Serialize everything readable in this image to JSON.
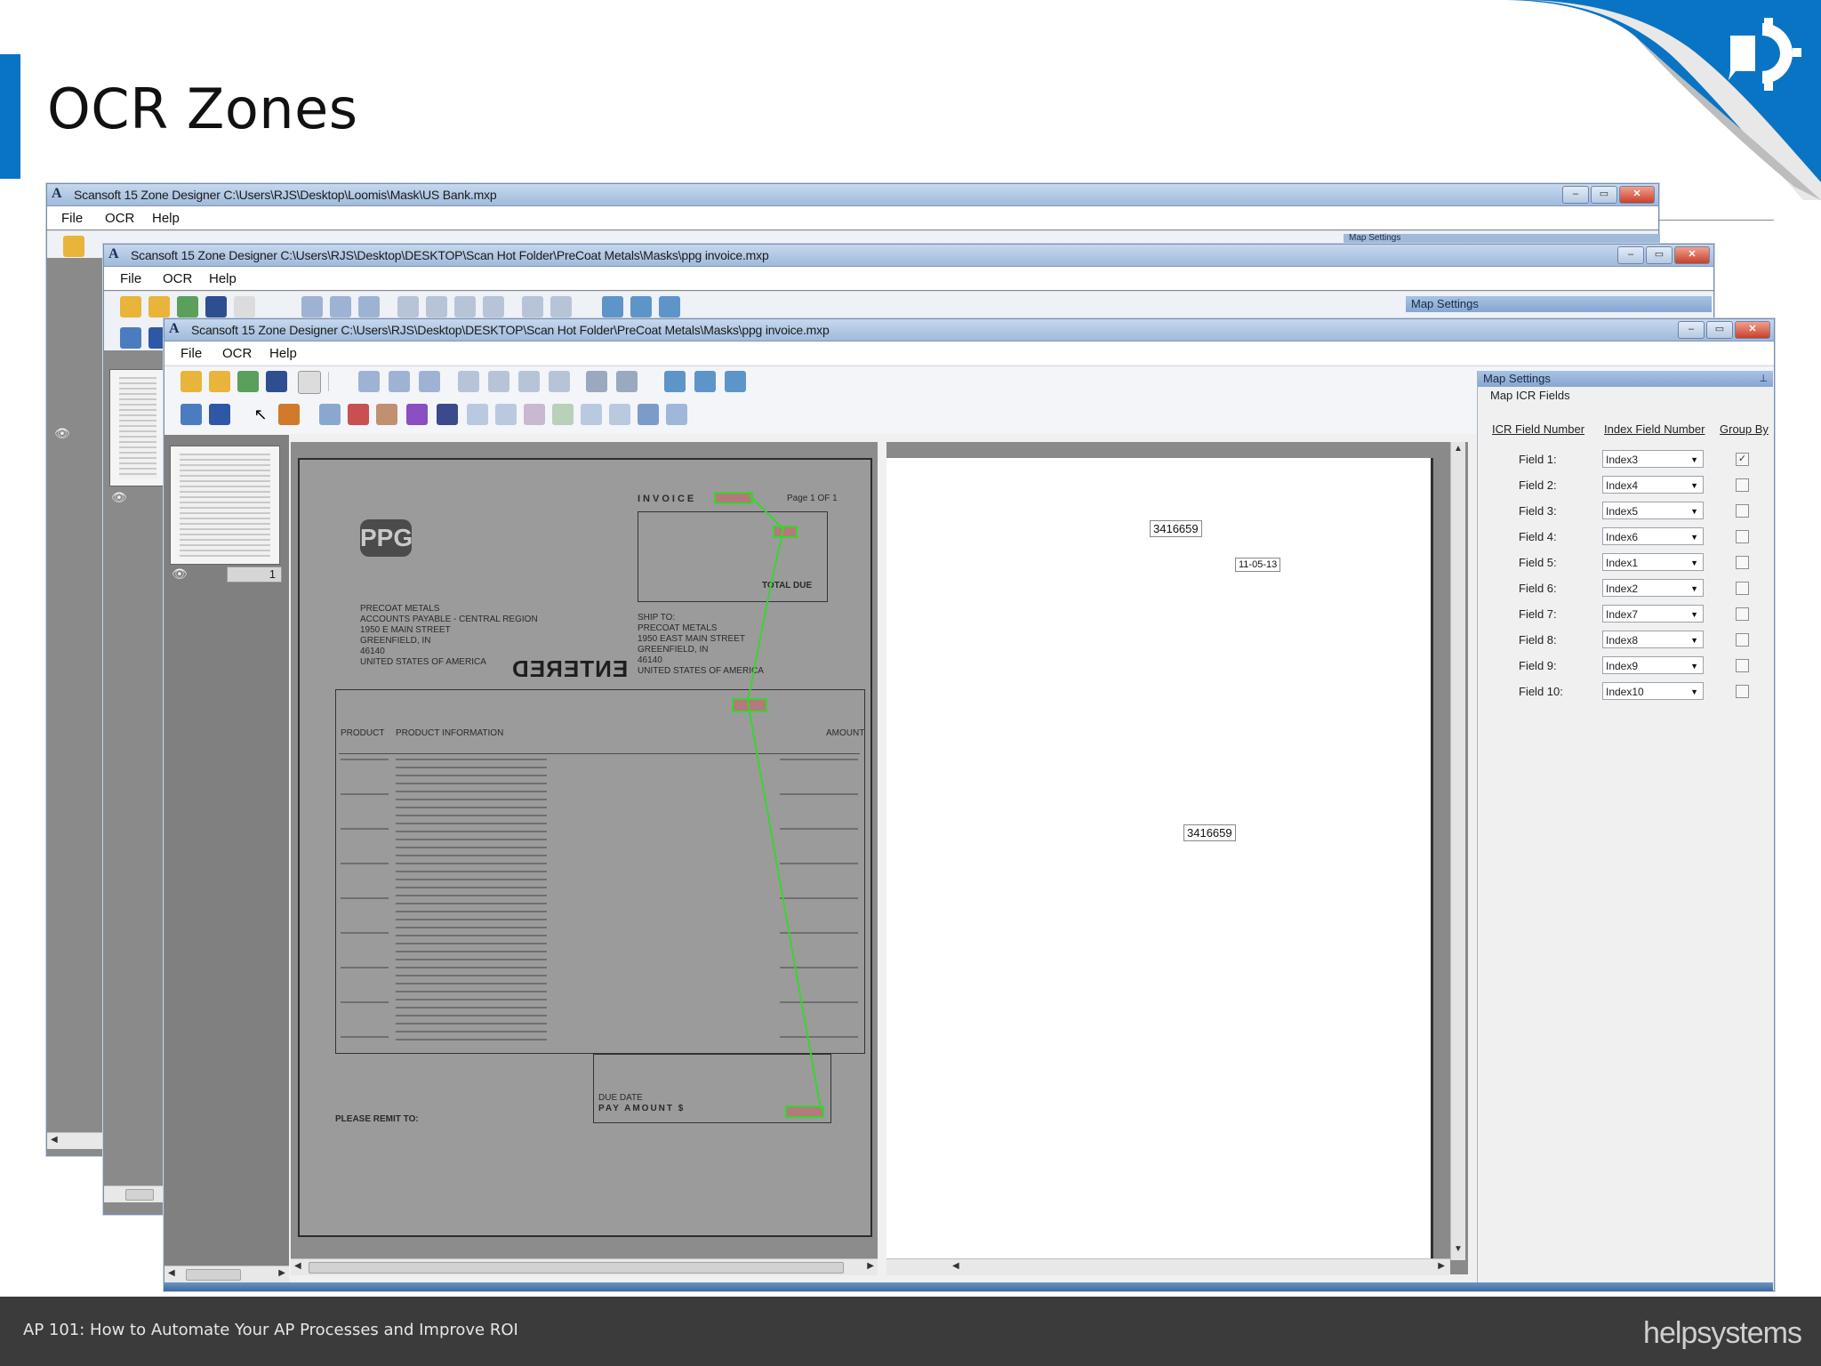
{
  "slide": {
    "title": "OCR Zones",
    "footer_text": "AP 101: How to Automate Your AP Processes and Improve ROI",
    "footer_logo": "helpsystems"
  },
  "colors": {
    "accent": "#0a74c4",
    "footer_bg": "#3b3b3b",
    "zone_green": "#3ad431"
  },
  "windows": [
    {
      "title": "Scansoft 15 Zone Designer C:\\Users\\RJS\\Desktop\\Loomis\\Mask\\US Bank.mxp",
      "menu": [
        "File",
        "OCR",
        "Help"
      ]
    },
    {
      "title": "Scansoft 15 Zone Designer C:\\Users\\RJS\\Desktop\\DESKTOP\\Scan Hot Folder\\PreCoat Metals\\Masks\\ppg invoice.mxp",
      "menu": [
        "File",
        "OCR",
        "Help"
      ]
    },
    {
      "title": "Scansoft 15 Zone Designer C:\\Users\\RJS\\Desktop\\DESKTOP\\Scan Hot Folder\\PreCoat Metals\\Masks\\ppg invoice.mxp",
      "menu": [
        "File",
        "OCR",
        "Help"
      ]
    }
  ],
  "map_settings": {
    "header": "Map Settings",
    "back_header_1": "Map Settings",
    "back_header_2": "Map Settings",
    "subheader": "Map ICR Fields",
    "columns": [
      "ICR Field Number",
      "Index Field Number",
      "Group By"
    ],
    "rows": [
      {
        "field": "Field 1:",
        "index": "Index3",
        "group": true
      },
      {
        "field": "Field 2:",
        "index": "Index4",
        "group": false
      },
      {
        "field": "Field 3:",
        "index": "Index5",
        "group": false
      },
      {
        "field": "Field 4:",
        "index": "Index6",
        "group": false
      },
      {
        "field": "Field 5:",
        "index": "Index1",
        "group": false
      },
      {
        "field": "Field 6:",
        "index": "Index2",
        "group": false
      },
      {
        "field": "Field 7:",
        "index": "Index7",
        "group": false
      },
      {
        "field": "Field 8:",
        "index": "Index8",
        "group": false
      },
      {
        "field": "Field 9:",
        "index": "Index9",
        "group": false
      },
      {
        "field": "Field 10:",
        "index": "Index10",
        "group": false
      }
    ]
  },
  "thumbnail_page": "1",
  "invoice": {
    "heading": "INVOICE",
    "page": "Page 1 OF 1",
    "stamp": "ENTERED",
    "total_due": "TOTAL DUE",
    "due_date": "DUE DATE",
    "pay_amount": "PAY AMOUNT  $",
    "remit": "PLEASE REMIT TO:",
    "bill_to": [
      "PRECOAT METALS",
      "ACCOUNTS PAYABLE - CENTRAL REGION",
      "1950 E MAIN STREET",
      "GREENFIELD, IN",
      "46140",
      "UNITED STATES OF AMERICA"
    ],
    "ship_to": [
      "SHIP TO:",
      "PRECOAT METALS",
      "1950 EAST MAIN STREET",
      "GREENFIELD, IN",
      "46140",
      "UNITED STATES OF AMERICA"
    ],
    "columns": [
      "PRODUCT",
      "PRODUCT INFORMATION",
      "AMOUNT"
    ]
  },
  "captured_fields": {
    "invoice_no_1": "3416659",
    "invoice_date": "11-05-13",
    "invoice_no_2": "3416659"
  },
  "icons": {
    "toolbar": [
      "open-folder-icon",
      "save-icon",
      "zoom-icon",
      "select-arrow-icon",
      "zone-icon"
    ],
    "corner": "helpsystems-logo-icon"
  }
}
